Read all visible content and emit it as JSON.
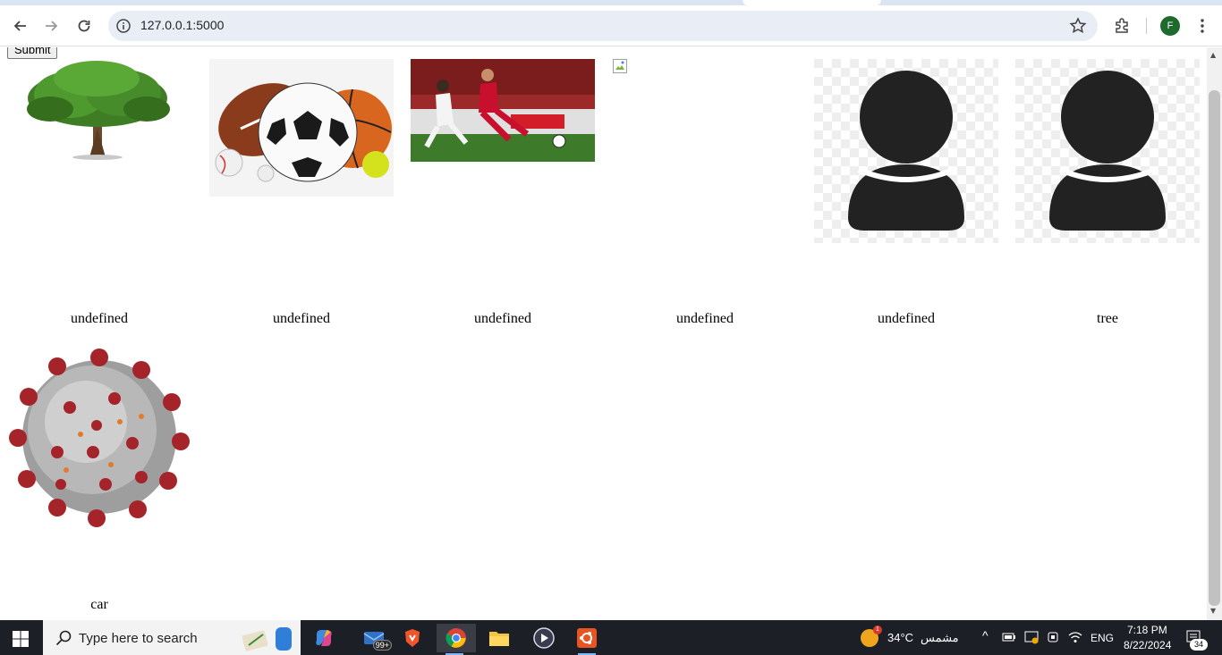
{
  "browser": {
    "url": "127.0.0.1:5000",
    "profile_initial": "F",
    "icons": [
      "back-icon",
      "forward-icon",
      "reload-icon",
      "site-info-icon",
      "bookmark-star-icon",
      "extensions-icon",
      "kebab-menu-icon"
    ]
  },
  "page": {
    "submit_label": "Submit",
    "cards": [
      {
        "label": "undefined",
        "image": "tree"
      },
      {
        "label": "undefined",
        "image": "sports balls"
      },
      {
        "label": "undefined",
        "image": "soccer players"
      },
      {
        "label": "undefined",
        "image": "broken image"
      },
      {
        "label": "undefined",
        "image": "user avatar"
      },
      {
        "label": "tree",
        "image": "user avatar"
      },
      {
        "label": "car",
        "image": "virus"
      }
    ]
  },
  "taskbar": {
    "search_placeholder": "Type here to search",
    "mail_badge": "99+",
    "weather_temp": "34°C",
    "weather_desc": "مشمس",
    "weather_alert": "1",
    "language": "ENG",
    "time": "7:18 PM",
    "date": "8/22/2024",
    "notification_count": "34",
    "colors": {
      "taskbar_bg": "#1c1f26",
      "accent": "#7fb4ff"
    }
  }
}
